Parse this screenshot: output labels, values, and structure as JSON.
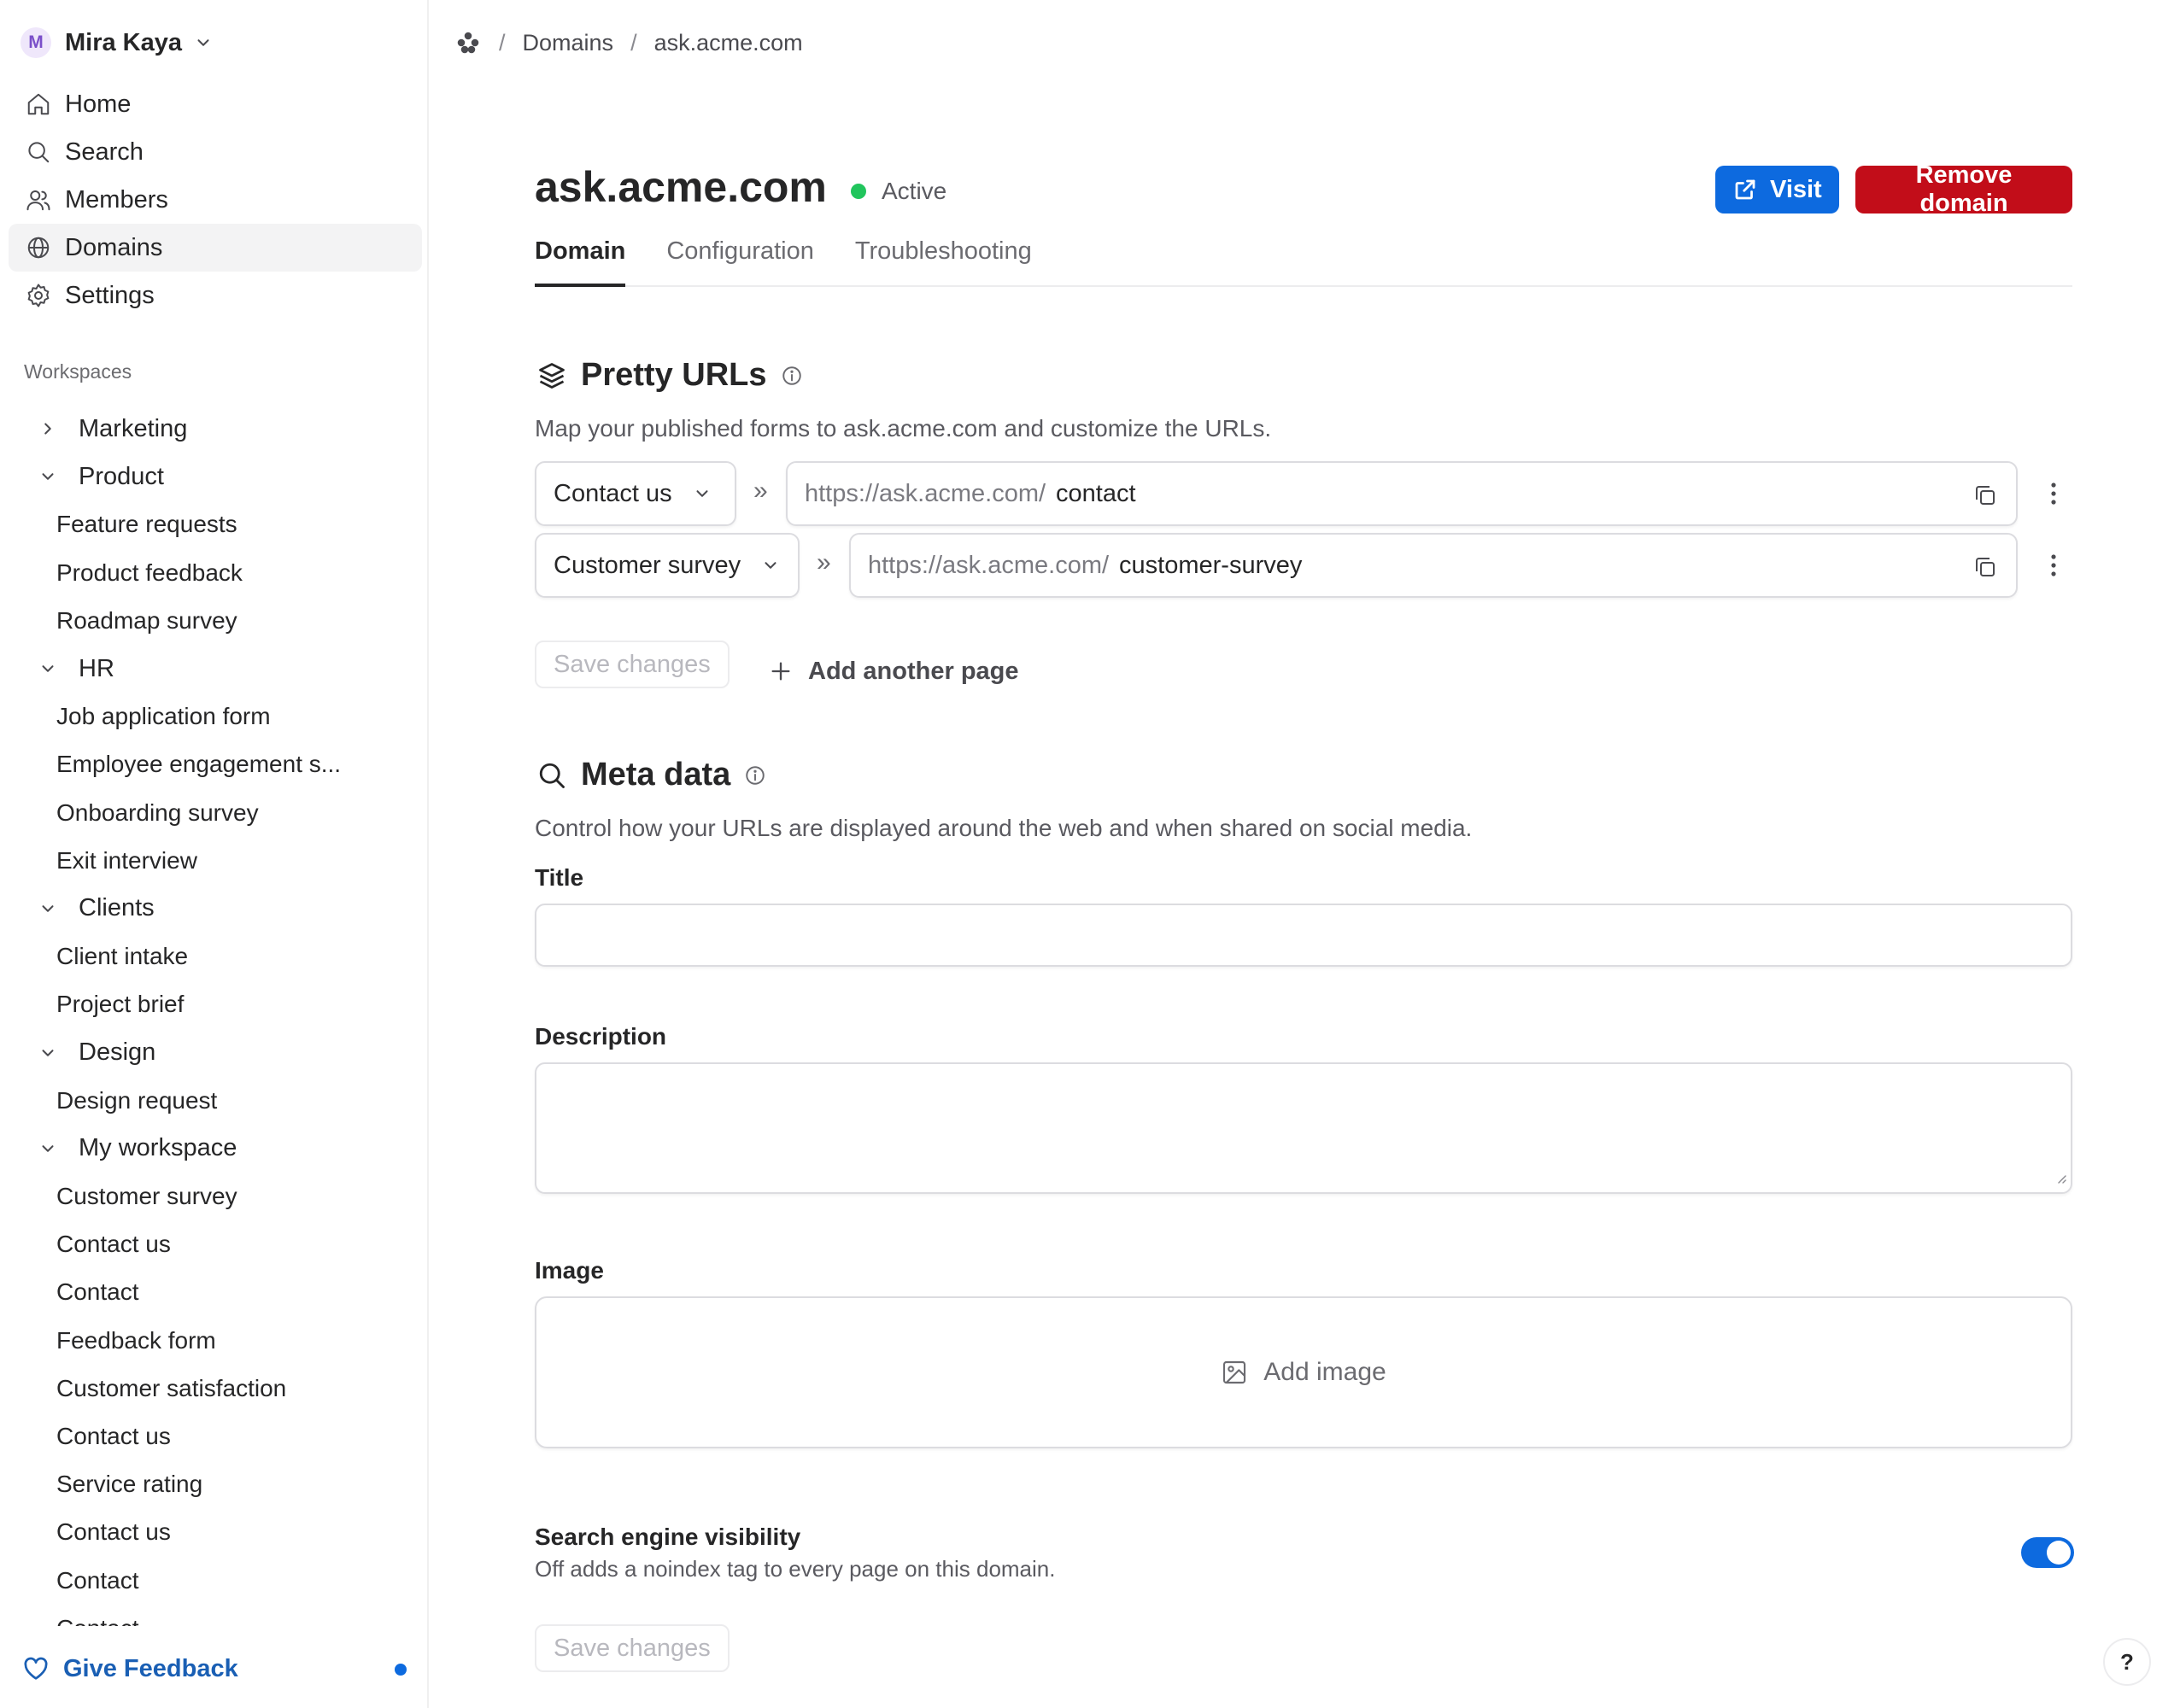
{
  "user": {
    "initial": "M",
    "name": "Mira Kaya"
  },
  "nav": {
    "items": [
      {
        "label": "Home",
        "icon": "home-icon"
      },
      {
        "label": "Search",
        "icon": "search-icon"
      },
      {
        "label": "Members",
        "icon": "members-icon"
      },
      {
        "label": "Domains",
        "icon": "globe-icon",
        "active": true
      },
      {
        "label": "Settings",
        "icon": "gear-icon"
      }
    ]
  },
  "workspaces": {
    "header": "Workspaces",
    "tree": [
      {
        "type": "group",
        "label": "Marketing",
        "expanded": false
      },
      {
        "type": "group",
        "label": "Product",
        "expanded": true
      },
      {
        "type": "leaf",
        "label": "Feature requests"
      },
      {
        "type": "leaf",
        "label": "Product feedback"
      },
      {
        "type": "leaf",
        "label": "Roadmap survey"
      },
      {
        "type": "group",
        "label": "HR",
        "expanded": true
      },
      {
        "type": "leaf",
        "label": "Job application form"
      },
      {
        "type": "leaf",
        "label": "Employee engagement s..."
      },
      {
        "type": "leaf",
        "label": "Onboarding survey"
      },
      {
        "type": "leaf",
        "label": "Exit interview"
      },
      {
        "type": "group",
        "label": "Clients",
        "expanded": true
      },
      {
        "type": "leaf",
        "label": "Client intake"
      },
      {
        "type": "leaf",
        "label": "Project brief"
      },
      {
        "type": "group",
        "label": "Design",
        "expanded": true
      },
      {
        "type": "leaf",
        "label": "Design request"
      },
      {
        "type": "group",
        "label": "My workspace",
        "expanded": true
      },
      {
        "type": "leaf",
        "label": "Customer survey"
      },
      {
        "type": "leaf",
        "label": "Contact us"
      },
      {
        "type": "leaf",
        "label": "Contact"
      },
      {
        "type": "leaf",
        "label": "Feedback form"
      },
      {
        "type": "leaf",
        "label": "Customer satisfaction"
      },
      {
        "type": "leaf",
        "label": "Contact us"
      },
      {
        "type": "leaf",
        "label": "Service rating"
      },
      {
        "type": "leaf",
        "label": "Contact us"
      },
      {
        "type": "leaf",
        "label": "Contact"
      },
      {
        "type": "leaf",
        "label": "Contact"
      }
    ]
  },
  "feedback": {
    "label": "Give Feedback"
  },
  "breadcrumb": {
    "sep": "/",
    "item1": "Domains",
    "item2": "ask.acme.com"
  },
  "header": {
    "title": "ask.acme.com",
    "status": "Active",
    "visit_label": "Visit",
    "remove_label": "Remove domain"
  },
  "tabs": [
    {
      "label": "Domain",
      "active": true
    },
    {
      "label": "Configuration"
    },
    {
      "label": "Troubleshooting"
    }
  ],
  "pretty_urls": {
    "title": "Pretty URLs",
    "description": "Map your published forms to ask.acme.com and customize the URLs.",
    "separator": "»",
    "rows": [
      {
        "page": "Contact us",
        "prefix": "https://ask.acme.com/",
        "slug": "contact"
      },
      {
        "page": "Customer survey",
        "prefix": "https://ask.acme.com/",
        "slug": "customer-survey"
      }
    ],
    "save_label": "Save changes",
    "add_label": "Add another page"
  },
  "meta": {
    "title": "Meta data",
    "description": "Control how your URLs are displayed around the web and when shared on social media.",
    "title_label": "Title",
    "title_value": "",
    "description_label": "Description",
    "description_value": "",
    "image_label": "Image",
    "add_image_label": "Add image",
    "sev_title": "Search engine visibility",
    "sev_desc": "Off adds a noindex tag to every page on this domain.",
    "sev_on": true,
    "save_label": "Save changes"
  },
  "help": {
    "label": "?"
  },
  "colors": {
    "accent": "#0d6adf",
    "danger": "#c20d19",
    "active": "#21c55d",
    "feedback": "#1a5fb4"
  }
}
